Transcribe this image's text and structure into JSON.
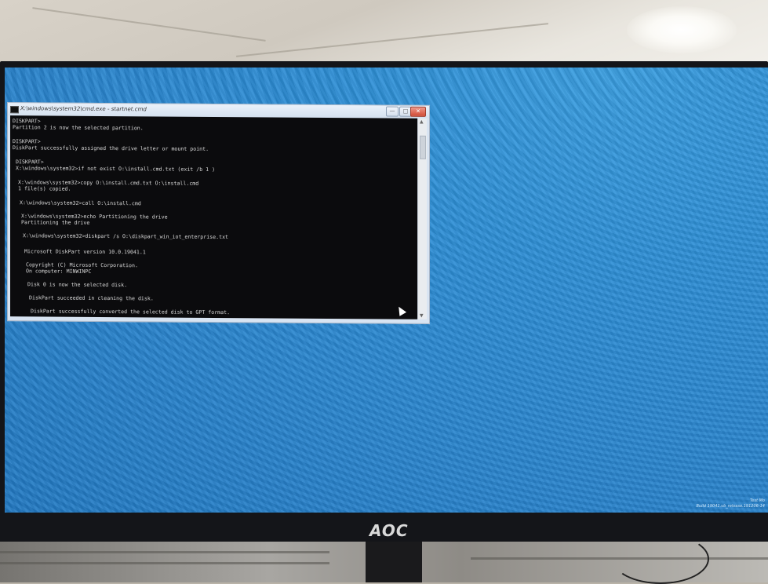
{
  "window": {
    "title": "X:\\windows\\system32\\cmd.exe - startnet.cmd",
    "minimize_glyph": "—",
    "maximize_glyph": "□",
    "close_glyph": "✕"
  },
  "console_lines": [
    "DISKPART>",
    "Partition 2 is now the selected partition.",
    "DISKPART>",
    "DiskPart successfully assigned the drive letter or mount point.",
    "DISKPART>",
    "X:\\windows\\system32>if not exist O:\\install.cmd.txt (exit /b 1 )",
    "X:\\windows\\system32>copy O:\\install.cmd.txt O:\\install.cmd",
    "        1 file(s) copied.",
    "X:\\windows\\system32>call O:\\install.cmd",
    "X:\\windows\\system32>echo Partitioning the drive",
    "Partitioning the drive",
    "X:\\windows\\system32>diskpart /s O:\\diskpart_win_iot_enterprise.txt",
    "Microsoft DiskPart version 10.0.19041.1",
    "Copyright (C) Microsoft Corporation.",
    "On computer: MINWINPC",
    "Disk 0 is now the selected disk.",
    "DiskPart succeeded in cleaning the disk.",
    "DiskPart successfully converted the selected disk to GPT format."
  ],
  "watermark": {
    "line1": "Test Mo",
    "line2": "Build 19041.vb_release.191206-14"
  },
  "monitor": {
    "brand": "AOC"
  },
  "icons": {
    "window_icon": "cmd-icon",
    "cursor": "mouse-pointer-icon"
  }
}
